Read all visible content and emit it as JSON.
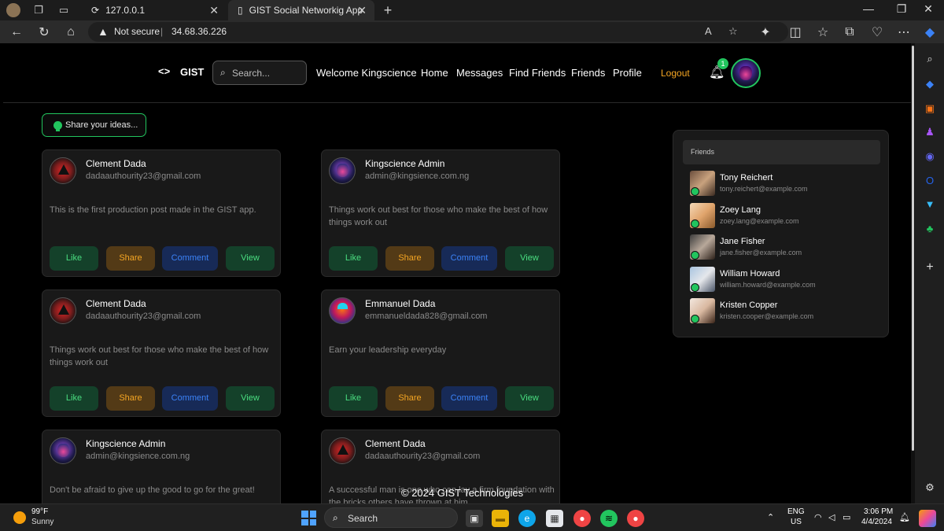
{
  "browser": {
    "tabs": [
      {
        "label": "127.0.0.1",
        "active": false
      },
      {
        "label": "GIST Social Networkig App",
        "active": true
      }
    ],
    "new_tab": "+",
    "address": {
      "security": "Not secure",
      "separator": "|",
      "url": "34.68.36.226"
    }
  },
  "site": {
    "brand": "GIST",
    "brand_icon": "<>",
    "search_placeholder": "Search...",
    "nav": [
      "Welcome Kingscience",
      "Home",
      "Messages",
      "Find Friends",
      "Friends",
      "Profile"
    ],
    "logout": "Logout",
    "notification_count": "1",
    "share_button": "Share your ideas..."
  },
  "posts": [
    {
      "name": "Clement Dada",
      "email": "dadaauthourity23@gmail.com",
      "body": "This is the first production post made in the GIST app.",
      "avatar": "red"
    },
    {
      "name": "Kingscience Admin",
      "email": "admin@kingsience.com.ng",
      "body": "Things work out best for those who make the best of how things work out",
      "avatar": "purple"
    },
    {
      "name": "Clement Dada",
      "email": "dadaauthourity23@gmail.com",
      "body": "Things work out best for those who make the best of how things work out",
      "avatar": "red"
    },
    {
      "name": "Emmanuel Dada",
      "email": "emmanueldada828@gmail.com",
      "body": "Earn your leadership everyday",
      "avatar": "colorful"
    },
    {
      "name": "Kingscience Admin",
      "email": "admin@kingsience.com.ng",
      "body": "Don't be afraid to give up the good to go for the great!",
      "avatar": "purple"
    },
    {
      "name": "Clement Dada",
      "email": "dadaauthourity23@gmail.com",
      "body": "A successful man is one who can lay a firm foundation with the bricks others have thrown at him",
      "avatar": "red"
    }
  ],
  "post_actions": {
    "like": "Like",
    "share": "Share",
    "comment": "Comment",
    "view": "View"
  },
  "friends": {
    "title": "Friends",
    "items": [
      {
        "name": "Tony Reichert",
        "email": "tony.reichert@example.com"
      },
      {
        "name": "Zoey Lang",
        "email": "zoey.lang@example.com"
      },
      {
        "name": "Jane Fisher",
        "email": "jane.fisher@example.com"
      },
      {
        "name": "William Howard",
        "email": "william.howard@example.com"
      },
      {
        "name": "Kristen Copper",
        "email": "kristen.cooper@example.com"
      }
    ]
  },
  "footer": "© 2024 GIST Technologies",
  "taskbar": {
    "weather_temp": "99°F",
    "weather_condition": "Sunny",
    "search_label": "Search",
    "lang": "ENG",
    "region": "US",
    "time": "3:06 PM",
    "date": "4/4/2024"
  },
  "colors": {
    "accent_green": "#22c55e",
    "logout_orange": "#f5a623",
    "comment_blue": "#3b82f6"
  }
}
